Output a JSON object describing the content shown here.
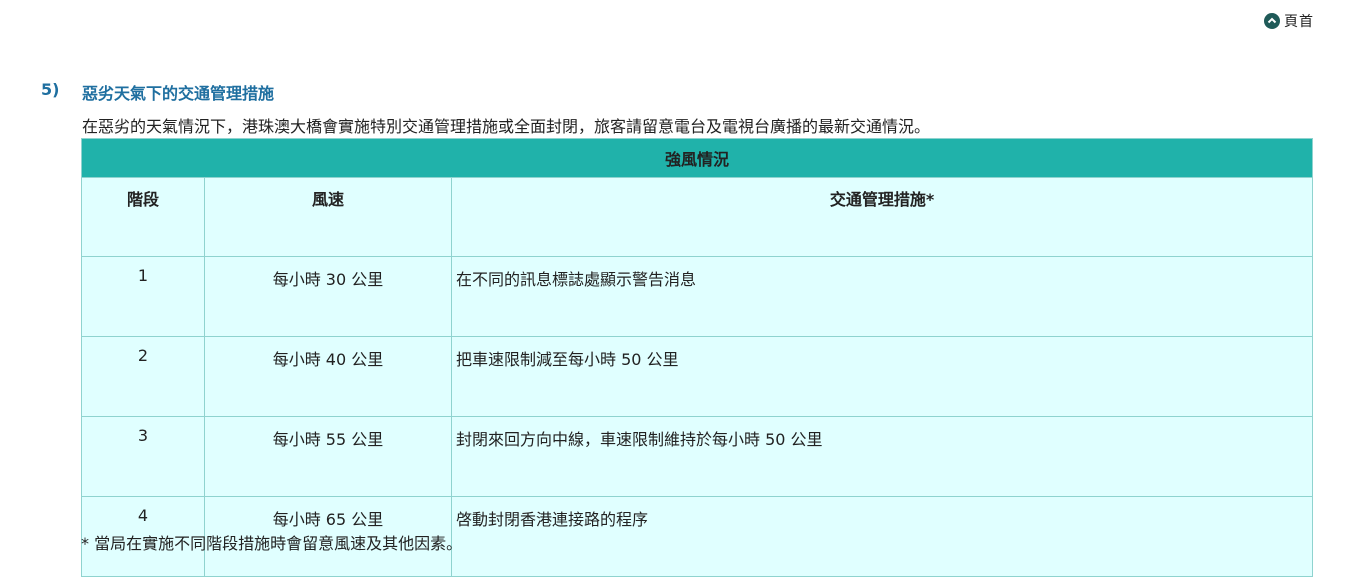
{
  "nav": {
    "top_link_label": "頁首",
    "top_icon": "chevron-up-circle-icon"
  },
  "section": {
    "number": "5)",
    "title": "惡劣天氣下的交通管理措施",
    "intro": "在惡劣的天氣情況下，港珠澳大橋會實施特別交通管理措施或全面封閉，旅客請留意電台及電視台廣播的最新交通情況。"
  },
  "table": {
    "caption": "強風情況",
    "headers": {
      "stage": "階段",
      "wind_speed": "風速",
      "measure": "交通管理措施*"
    },
    "rows": [
      {
        "stage": "1",
        "wind_speed": "每小時 30 公里",
        "measure": "在不同的訊息標誌處顯示警告消息"
      },
      {
        "stage": "2",
        "wind_speed": "每小時 40 公里",
        "measure": "把車速限制減至每小時 50 公里"
      },
      {
        "stage": "3",
        "wind_speed": "每小時 55 公里",
        "measure": "封閉來回方向中線，車速限制維持於每小時 50 公里"
      },
      {
        "stage": "4",
        "wind_speed": "每小時 65 公里",
        "measure": "啓動封閉香港連接路的程序"
      }
    ]
  },
  "footnote": "* 當局在實施不同階段措施時會留意風速及其他因素。",
  "colors": {
    "header_bg": "#20b2aa",
    "cell_bg": "#e0ffff",
    "heading_text": "#1f6fa0",
    "border": "#8fd3cf"
  }
}
